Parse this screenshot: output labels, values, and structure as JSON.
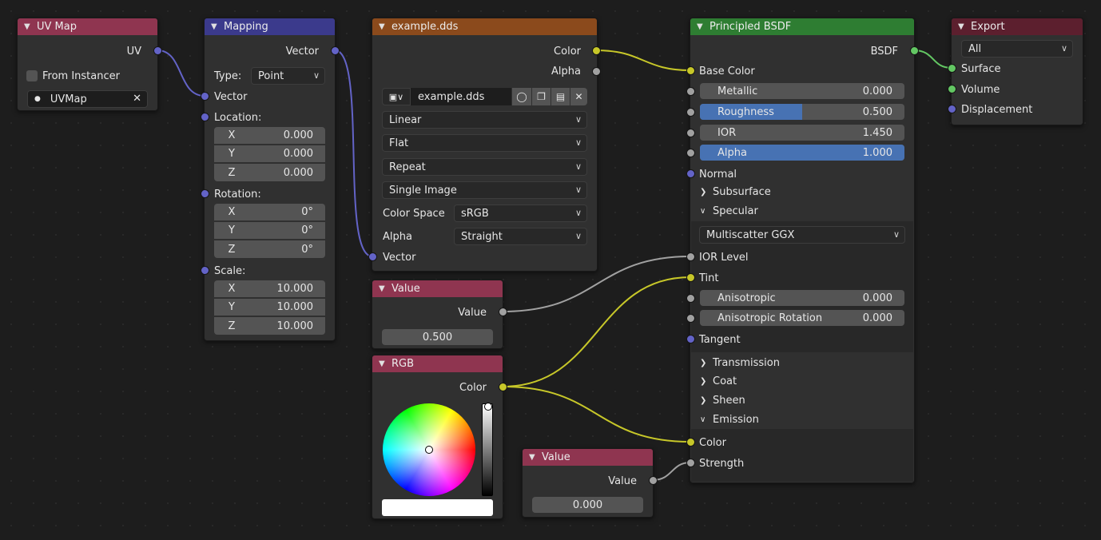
{
  "colors": {
    "uvmap_header": "#8f3550",
    "mapping_header": "#3b3a8c",
    "image_header": "#8b4a1c",
    "value_header": "#8f3550",
    "rgb_header": "#8f3550",
    "bsdf_header": "#2e7d32",
    "export_header": "#5c1f2e",
    "vector_socket": "#6363c7",
    "color_socket": "#c7c729",
    "float_socket": "#a1a1a1",
    "shader_socket": "#63c763",
    "slider_fill": "#4772b3"
  },
  "uvmap": {
    "title": "UV Map",
    "output": "UV",
    "from_instancer": "From Instancer",
    "uv_name": "UVMap"
  },
  "mapping": {
    "title": "Mapping",
    "output": "Vector",
    "type_label": "Type:",
    "type_value": "Point",
    "input_vector": "Vector",
    "location_label": "Location:",
    "rotation_label": "Rotation:",
    "scale_label": "Scale:",
    "location": [
      {
        "axis": "X",
        "value": "0.000"
      },
      {
        "axis": "Y",
        "value": "0.000"
      },
      {
        "axis": "Z",
        "value": "0.000"
      }
    ],
    "rotation": [
      {
        "axis": "X",
        "value": "0°"
      },
      {
        "axis": "Y",
        "value": "0°"
      },
      {
        "axis": "Z",
        "value": "0°"
      }
    ],
    "scale": [
      {
        "axis": "X",
        "value": "10.000"
      },
      {
        "axis": "Y",
        "value": "10.000"
      },
      {
        "axis": "Z",
        "value": "10.000"
      }
    ]
  },
  "image": {
    "title": "example.dds",
    "out_color": "Color",
    "out_alpha": "Alpha",
    "image_name": "example.dds",
    "interpolation": "Linear",
    "projection": "Flat",
    "extension": "Repeat",
    "source": "Single Image",
    "colorspace_label": "Color Space",
    "colorspace": "sRGB",
    "alpha_label": "Alpha",
    "alpha_mode": "Straight",
    "input_vector": "Vector"
  },
  "value1": {
    "title": "Value",
    "output": "Value",
    "value": "0.500"
  },
  "rgb": {
    "title": "RGB",
    "output": "Color"
  },
  "value2": {
    "title": "Value",
    "output": "Value",
    "value": "0.000"
  },
  "bsdf": {
    "title": "Principled BSDF",
    "output": "BSDF",
    "base_color": "Base Color",
    "metallic_label": "Metallic",
    "metallic": "0.000",
    "roughness_label": "Roughness",
    "roughness": "0.500",
    "roughness_fill": 0.5,
    "ior_label": "IOR",
    "ior": "1.450",
    "alpha_label": "Alpha",
    "alpha": "1.000",
    "alpha_fill": 1.0,
    "normal": "Normal",
    "subsurface": "Subsurface",
    "specular": "Specular",
    "distribution": "Multiscatter GGX",
    "ior_level": "IOR Level",
    "tint": "Tint",
    "aniso_label": "Anisotropic",
    "aniso": "0.000",
    "aniso_rot_label": "Anisotropic Rotation",
    "aniso_rot": "0.000",
    "tangent": "Tangent",
    "transmission": "Transmission",
    "coat": "Coat",
    "sheen": "Sheen",
    "emission": "Emission",
    "emission_color": "Color",
    "emission_strength": "Strength"
  },
  "export": {
    "title": "Export",
    "target": "All",
    "surface": "Surface",
    "volume": "Volume",
    "displacement": "Displacement"
  }
}
